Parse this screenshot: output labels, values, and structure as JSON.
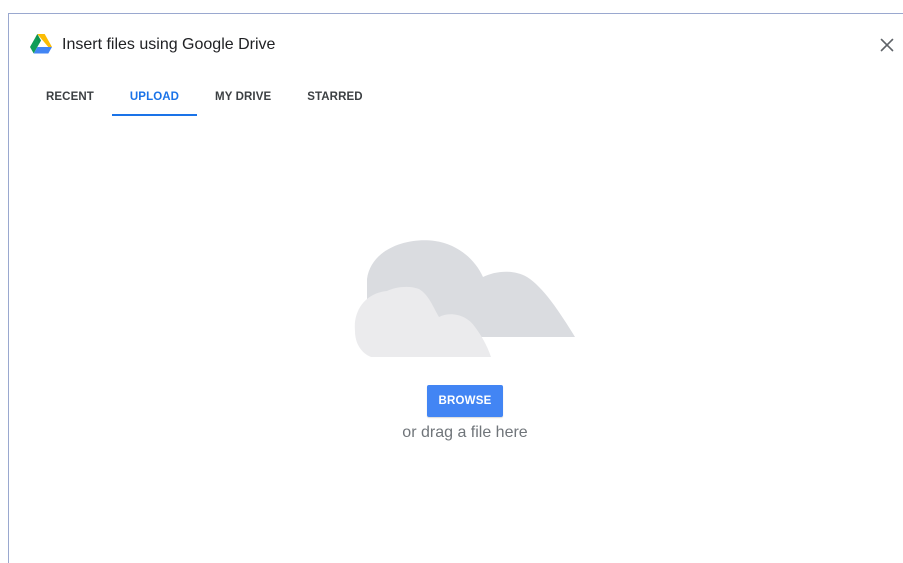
{
  "dialog": {
    "title": "Insert files using Google Drive",
    "logo_icon": "google-drive-logo",
    "close_icon": "close-icon"
  },
  "tabs": [
    {
      "label": "RECENT",
      "active": false
    },
    {
      "label": "UPLOAD",
      "active": true
    },
    {
      "label": "MY DRIVE",
      "active": false
    },
    {
      "label": "STARRED",
      "active": false
    }
  ],
  "upload": {
    "illustration_icon": "cloud-illustration",
    "browse_label": "BROWSE",
    "drag_text": "or drag a file here"
  },
  "colors": {
    "accent": "#1a73e8",
    "button": "#4285f4",
    "tab_text": "#3c4043",
    "hint_text": "#70757a",
    "cloud_back": "#dadce0",
    "cloud_front": "#ebebed"
  }
}
